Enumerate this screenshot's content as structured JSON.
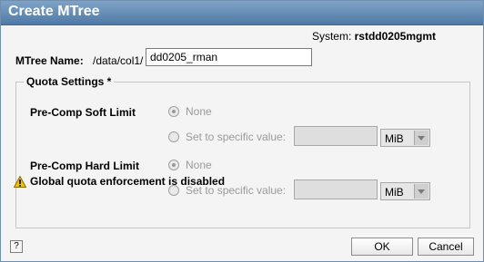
{
  "title": "Create MTree",
  "system": {
    "label": "System:",
    "value": "rstdd0205mgmt"
  },
  "mtree": {
    "label": "MTree Name:",
    "prefix": "/data/col1/",
    "value": "dd0205_rman"
  },
  "quota": {
    "legend": "Quota Settings *",
    "soft": {
      "label": "Pre-Comp Soft Limit",
      "none_label": "None",
      "specific_label": "Set to specific value:",
      "value": "",
      "unit": "MiB",
      "selected": "None"
    },
    "hard": {
      "label": "Pre-Comp Hard Limit",
      "none_label": "None",
      "specific_label": "Set to specific value:",
      "value": "",
      "unit": "MiB",
      "selected": "None"
    },
    "warning": "Global quota enforcement is disabled"
  },
  "footer": {
    "help_label": "?",
    "ok_label": "OK",
    "cancel_label": "Cancel"
  },
  "colors": {
    "titlebar": "#5f87b1",
    "title_text": "#ffffff",
    "disabled_text": "#9a9a9a"
  }
}
